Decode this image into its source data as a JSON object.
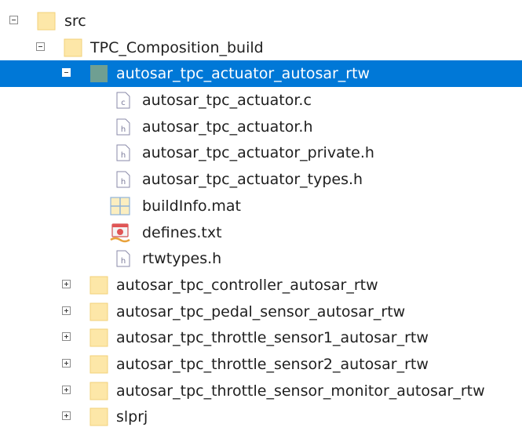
{
  "tree": {
    "src": "src",
    "tpc_composition_build": "TPC_Composition_build",
    "actuator_folder": "autosar_tpc_actuator_autosar_rtw",
    "files": {
      "actuator_c": "autosar_tpc_actuator.c",
      "actuator_h": "autosar_tpc_actuator.h",
      "actuator_private_h": "autosar_tpc_actuator_private.h",
      "actuator_types_h": "autosar_tpc_actuator_types.h",
      "buildinfo_mat": "buildInfo.mat",
      "defines_txt": "defines.txt",
      "rtwtypes_h": "rtwtypes.h"
    },
    "controller_folder": "autosar_tpc_controller_autosar_rtw",
    "pedal_sensor_folder": "autosar_tpc_pedal_sensor_autosar_rtw",
    "throttle_sensor1_folder": "autosar_tpc_throttle_sensor1_autosar_rtw",
    "throttle_sensor2_folder": "autosar_tpc_throttle_sensor2_autosar_rtw",
    "throttle_sensor_monitor_folder": "autosar_tpc_throttle_sensor_monitor_autosar_rtw",
    "slprj_folder": "slprj"
  },
  "colors": {
    "selection": "#0078d7",
    "folder": "#fde7a8",
    "folder_selected": "#6f9f92"
  }
}
